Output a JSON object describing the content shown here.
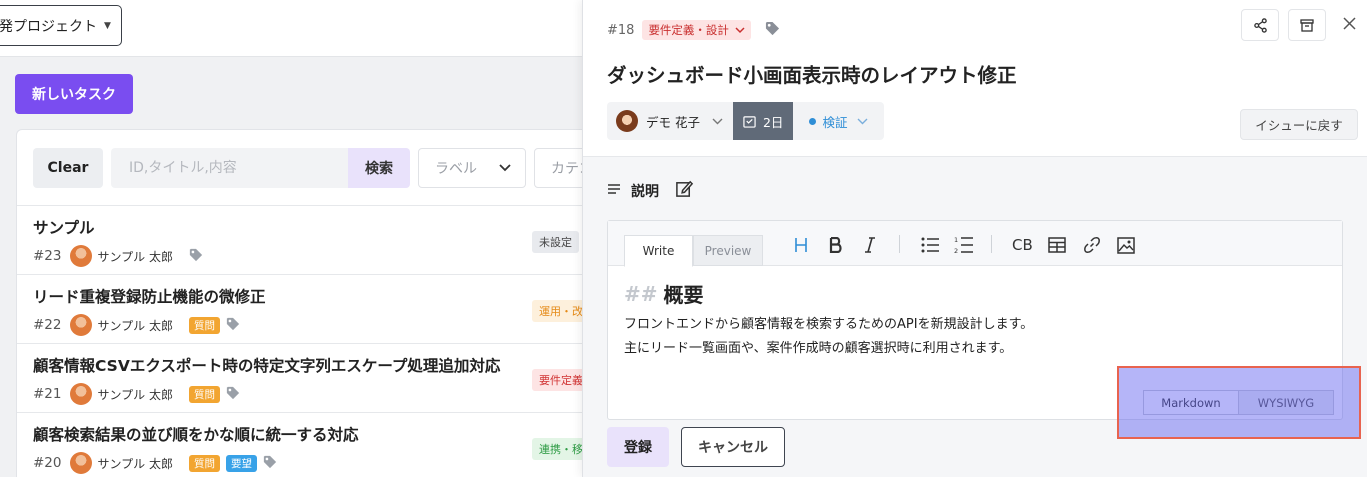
{
  "project": {
    "label": "発プロジェクト"
  },
  "actions": {
    "new_task": "新しいタスク"
  },
  "filter": {
    "clear": "Clear",
    "search_placeholder": "ID,タイトル,内容",
    "search_button": "検索",
    "label_select": "ラベル",
    "category_select": "カテゴ"
  },
  "tasks": [
    {
      "title": "サンプル",
      "id": "#23",
      "user": "サンプル 太郎",
      "badges": [],
      "status": "未設定",
      "status_color": "#e8eaee"
    },
    {
      "title": "リード重複登録防止機能の微修正",
      "id": "#22",
      "user": "サンプル 太郎",
      "badges": [
        "質問"
      ],
      "status": "運用・改",
      "status_color": "#fdf0dc"
    },
    {
      "title": "顧客情報CSVエクスポート時の特定文字列エスケープ処理追加対応",
      "id": "#21",
      "user": "サンプル 太郎",
      "badges": [
        "質問"
      ],
      "status": "要件定義",
      "status_color": "#fde4e4"
    },
    {
      "title": "顧客検索結果の並び順をかな順に統一する対応",
      "id": "#20",
      "user": "サンプル 太郎",
      "badges": [
        "質問",
        "要望"
      ],
      "status": "連携・移",
      "status_color": "#e3f5e6"
    }
  ],
  "issue": {
    "id": "#18",
    "category": "要件定義・設計",
    "title": "ダッシュボード小画面表示時のレイアウト修正",
    "assignee": "デモ 花子",
    "due": "2日",
    "state": "検証",
    "back_button": "イシューに戻す"
  },
  "description": {
    "heading": "説明",
    "tab_write": "Write",
    "tab_preview": "Preview",
    "body_hash": "##",
    "body_heading": "概要",
    "body_lines": [
      "フロントエンドから顧客情報を検索するためのAPIを新規設計します。",
      "主にリード一覧画面や、案件作成時の顧客選択時に利用されます。"
    ],
    "toolbar_cb": "CB",
    "mode_markdown": "Markdown",
    "mode_wysiwyg": "WYSIWYG"
  },
  "form": {
    "submit": "登録",
    "cancel": "キャンセル"
  },
  "colors": {
    "accent": "#7a4df0",
    "state": "#2f8ed6",
    "highlight": "#5a5af0",
    "highlight_border": "#e8634f"
  }
}
